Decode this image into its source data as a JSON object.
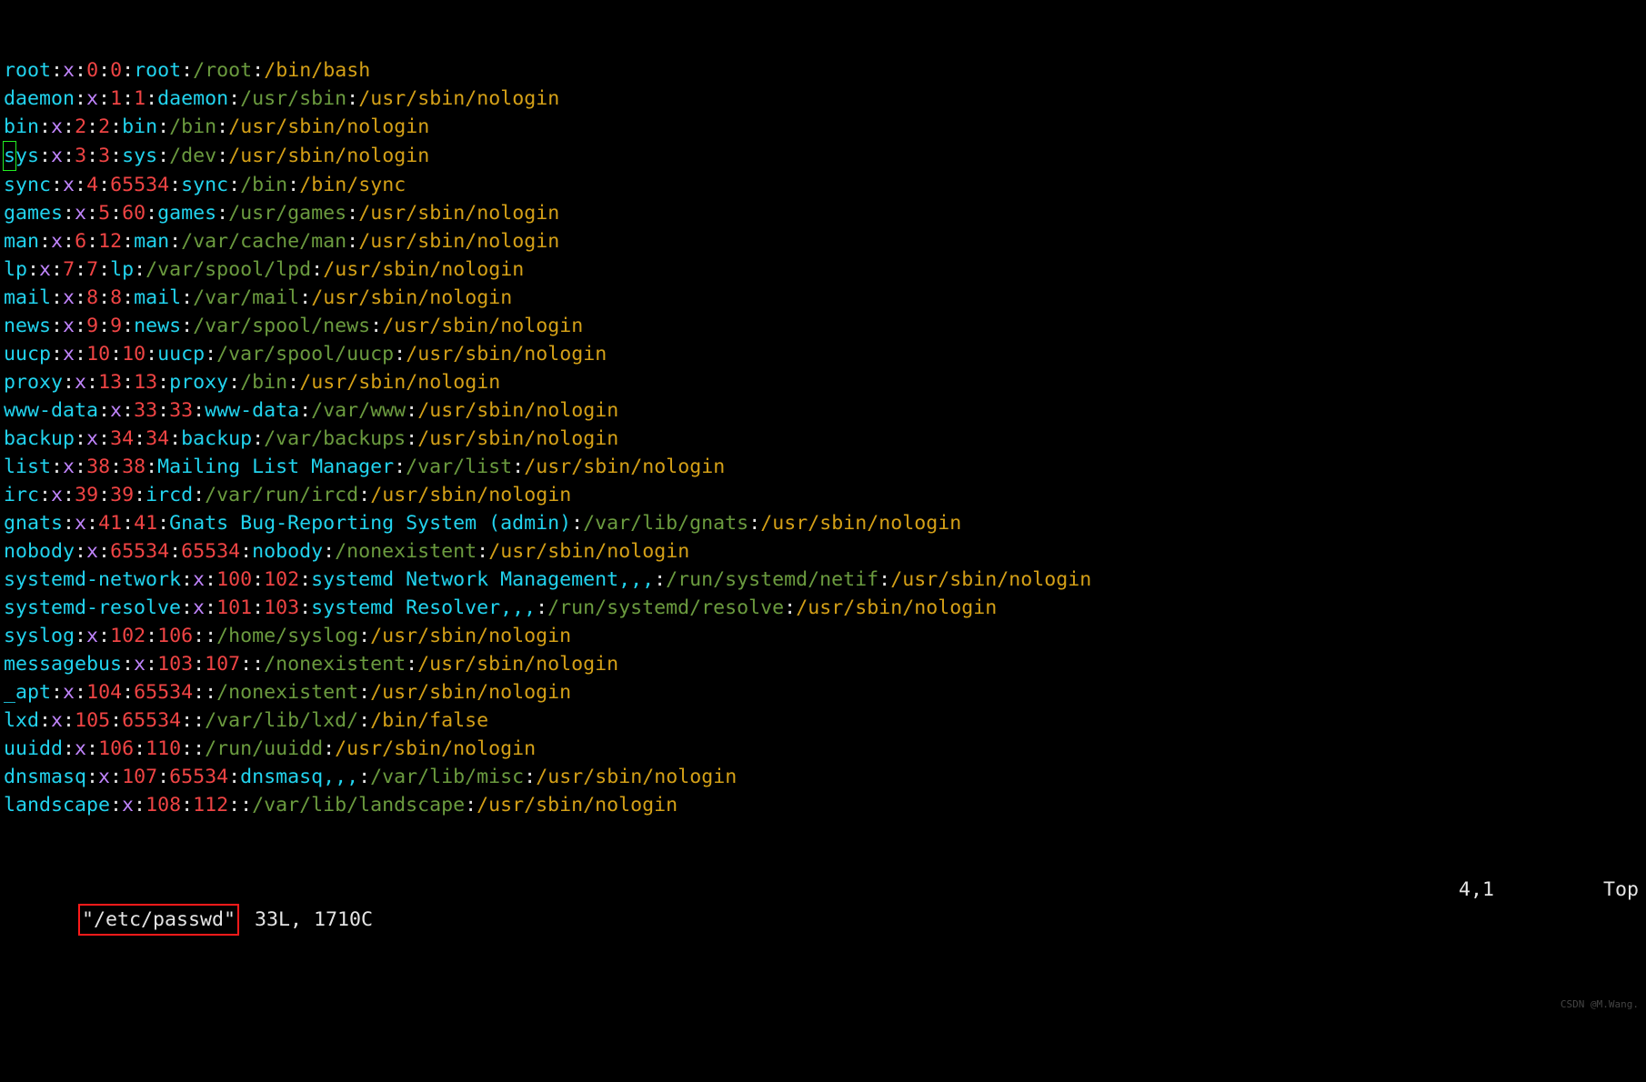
{
  "entries": [
    {
      "user": "root",
      "x": "x",
      "uid": "0",
      "gid": "0",
      "gecos": "root",
      "home": "/root",
      "shell": "/bin/bash",
      "cursor": false
    },
    {
      "user": "daemon",
      "x": "x",
      "uid": "1",
      "gid": "1",
      "gecos": "daemon",
      "home": "/usr/sbin",
      "shell": "/usr/sbin/nologin",
      "cursor": false
    },
    {
      "user": "bin",
      "x": "x",
      "uid": "2",
      "gid": "2",
      "gecos": "bin",
      "home": "/bin",
      "shell": "/usr/sbin/nologin",
      "cursor": false
    },
    {
      "user": "sys",
      "x": "x",
      "uid": "3",
      "gid": "3",
      "gecos": "sys",
      "home": "/dev",
      "shell": "/usr/sbin/nologin",
      "cursor": true
    },
    {
      "user": "sync",
      "x": "x",
      "uid": "4",
      "gid": "65534",
      "gecos": "sync",
      "home": "/bin",
      "shell": "/bin/sync",
      "cursor": false
    },
    {
      "user": "games",
      "x": "x",
      "uid": "5",
      "gid": "60",
      "gecos": "games",
      "home": "/usr/games",
      "shell": "/usr/sbin/nologin",
      "cursor": false
    },
    {
      "user": "man",
      "x": "x",
      "uid": "6",
      "gid": "12",
      "gecos": "man",
      "home": "/var/cache/man",
      "shell": "/usr/sbin/nologin",
      "cursor": false
    },
    {
      "user": "lp",
      "x": "x",
      "uid": "7",
      "gid": "7",
      "gecos": "lp",
      "home": "/var/spool/lpd",
      "shell": "/usr/sbin/nologin",
      "cursor": false
    },
    {
      "user": "mail",
      "x": "x",
      "uid": "8",
      "gid": "8",
      "gecos": "mail",
      "home": "/var/mail",
      "shell": "/usr/sbin/nologin",
      "cursor": false
    },
    {
      "user": "news",
      "x": "x",
      "uid": "9",
      "gid": "9",
      "gecos": "news",
      "home": "/var/spool/news",
      "shell": "/usr/sbin/nologin",
      "cursor": false
    },
    {
      "user": "uucp",
      "x": "x",
      "uid": "10",
      "gid": "10",
      "gecos": "uucp",
      "home": "/var/spool/uucp",
      "shell": "/usr/sbin/nologin",
      "cursor": false
    },
    {
      "user": "proxy",
      "x": "x",
      "uid": "13",
      "gid": "13",
      "gecos": "proxy",
      "home": "/bin",
      "shell": "/usr/sbin/nologin",
      "cursor": false
    },
    {
      "user": "www-data",
      "x": "x",
      "uid": "33",
      "gid": "33",
      "gecos": "www-data",
      "home": "/var/www",
      "shell": "/usr/sbin/nologin",
      "cursor": false
    },
    {
      "user": "backup",
      "x": "x",
      "uid": "34",
      "gid": "34",
      "gecos": "backup",
      "home": "/var/backups",
      "shell": "/usr/sbin/nologin",
      "cursor": false
    },
    {
      "user": "list",
      "x": "x",
      "uid": "38",
      "gid": "38",
      "gecos": "Mailing List Manager",
      "home": "/var/list",
      "shell": "/usr/sbin/nologin",
      "cursor": false
    },
    {
      "user": "irc",
      "x": "x",
      "uid": "39",
      "gid": "39",
      "gecos": "ircd",
      "home": "/var/run/ircd",
      "shell": "/usr/sbin/nologin",
      "cursor": false
    },
    {
      "user": "gnats",
      "x": "x",
      "uid": "41",
      "gid": "41",
      "gecos": "Gnats Bug-Reporting System (admin)",
      "home": "/var/lib/gnats",
      "shell": "/usr/sbin/nologin",
      "cursor": false
    },
    {
      "user": "nobody",
      "x": "x",
      "uid": "65534",
      "gid": "65534",
      "gecos": "nobody",
      "home": "/nonexistent",
      "shell": "/usr/sbin/nologin",
      "cursor": false
    },
    {
      "user": "systemd-network",
      "x": "x",
      "uid": "100",
      "gid": "102",
      "gecos": "systemd Network Management,,,",
      "home": "/run/systemd/netif",
      "shell": "/usr/sbin/nologin",
      "cursor": false
    },
    {
      "user": "systemd-resolve",
      "x": "x",
      "uid": "101",
      "gid": "103",
      "gecos": "systemd Resolver,,,",
      "home": "/run/systemd/resolve",
      "shell": "/usr/sbin/nologin",
      "cursor": false
    },
    {
      "user": "syslog",
      "x": "x",
      "uid": "102",
      "gid": "106",
      "gecos": "",
      "home": "/home/syslog",
      "shell": "/usr/sbin/nologin",
      "cursor": false
    },
    {
      "user": "messagebus",
      "x": "x",
      "uid": "103",
      "gid": "107",
      "gecos": "",
      "home": "/nonexistent",
      "shell": "/usr/sbin/nologin",
      "cursor": false
    },
    {
      "user": "_apt",
      "x": "x",
      "uid": "104",
      "gid": "65534",
      "gecos": "",
      "home": "/nonexistent",
      "shell": "/usr/sbin/nologin",
      "cursor": false
    },
    {
      "user": "lxd",
      "x": "x",
      "uid": "105",
      "gid": "65534",
      "gecos": "",
      "home": "/var/lib/lxd/",
      "shell": "/bin/false",
      "cursor": false
    },
    {
      "user": "uuidd",
      "x": "x",
      "uid": "106",
      "gid": "110",
      "gecos": "",
      "home": "/run/uuidd",
      "shell": "/usr/sbin/nologin",
      "cursor": false
    },
    {
      "user": "dnsmasq",
      "x": "x",
      "uid": "107",
      "gid": "65534",
      "gecos": "dnsmasq,,,",
      "home": "/var/lib/misc",
      "shell": "/usr/sbin/nologin",
      "cursor": false
    },
    {
      "user": "landscape",
      "x": "x",
      "uid": "108",
      "gid": "112",
      "gecos": "",
      "home": "/var/lib/landscape",
      "shell": "/usr/sbin/nologin",
      "cursor": false
    }
  ],
  "status": {
    "filename": "\"/etc/passwd\"",
    "stats": " 33L, 1710C",
    "position": "4,1",
    "scroll": "Top"
  },
  "watermark": "CSDN @M.Wang."
}
